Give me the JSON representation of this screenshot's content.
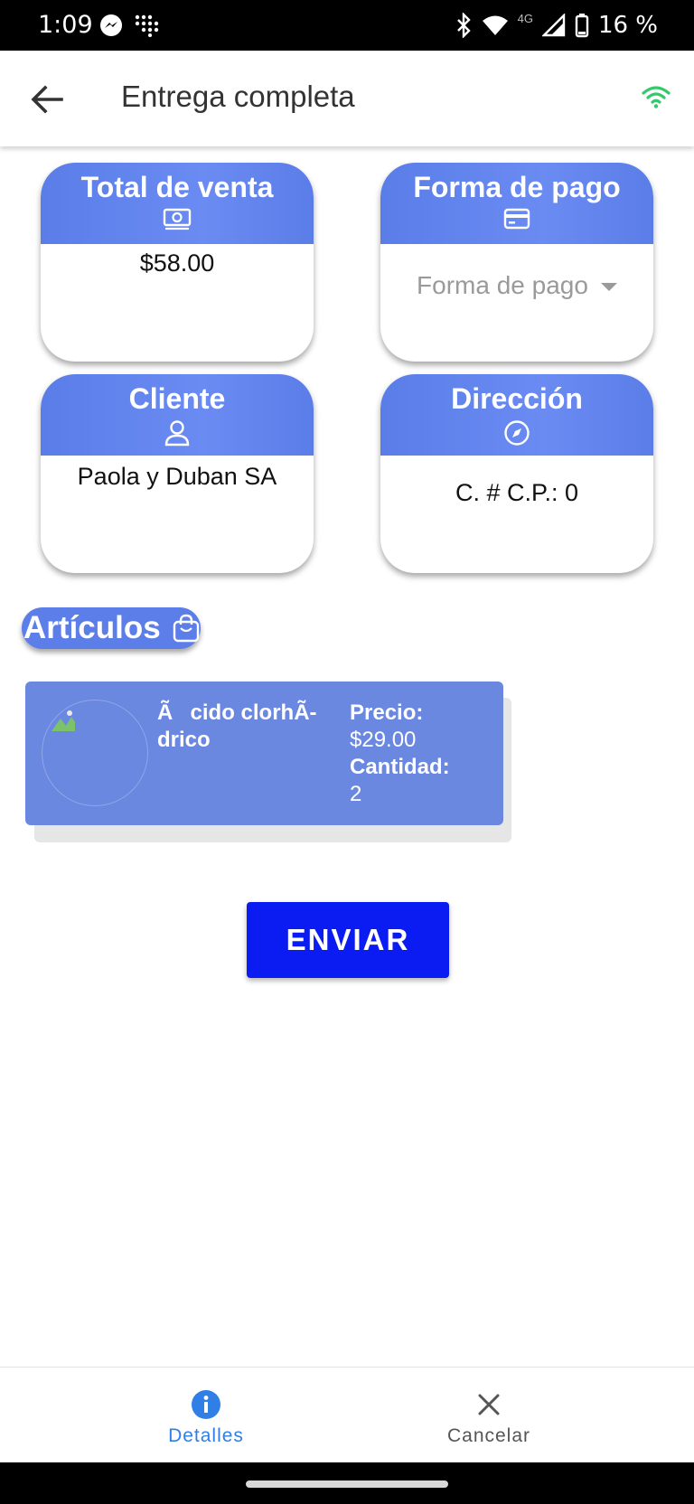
{
  "status_bar": {
    "time": "1:09",
    "network": "4G",
    "battery": "16 %"
  },
  "app_bar": {
    "title": "Entrega completa",
    "back_icon": "arrow-back-icon",
    "status_icon": "wifi-icon",
    "status_color": "#34c96a"
  },
  "cards": {
    "total": {
      "title": "Total de venta",
      "icon": "money-icon",
      "value": "$58.00"
    },
    "payment": {
      "title": "Forma de pago",
      "icon": "credit-card-icon",
      "placeholder": "Forma de pago"
    },
    "client": {
      "title": "Cliente",
      "icon": "person-icon",
      "value": "Paola y Duban SA"
    },
    "address": {
      "title": "Dirección",
      "icon": "compass-icon",
      "value": "C. # C.P.: 0"
    }
  },
  "articles": {
    "label": "Artículos",
    "icon": "shopping-bag-icon",
    "items": [
      {
        "name": "Ãcido clorhÃ­drico",
        "price_label": "Precio:",
        "price": "$29.00",
        "qty_label": "Cantidad:",
        "qty": "2"
      }
    ]
  },
  "send_button": {
    "label": "ENVIAR",
    "color": "#0a1cf2"
  },
  "bottom_nav": {
    "items": [
      {
        "label": "Detalles",
        "icon": "info-icon",
        "active": true
      },
      {
        "label": "Cancelar",
        "icon": "close-icon",
        "active": false
      }
    ],
    "active_color": "#2f7fe6"
  },
  "accent_color": "#5c7ee8"
}
